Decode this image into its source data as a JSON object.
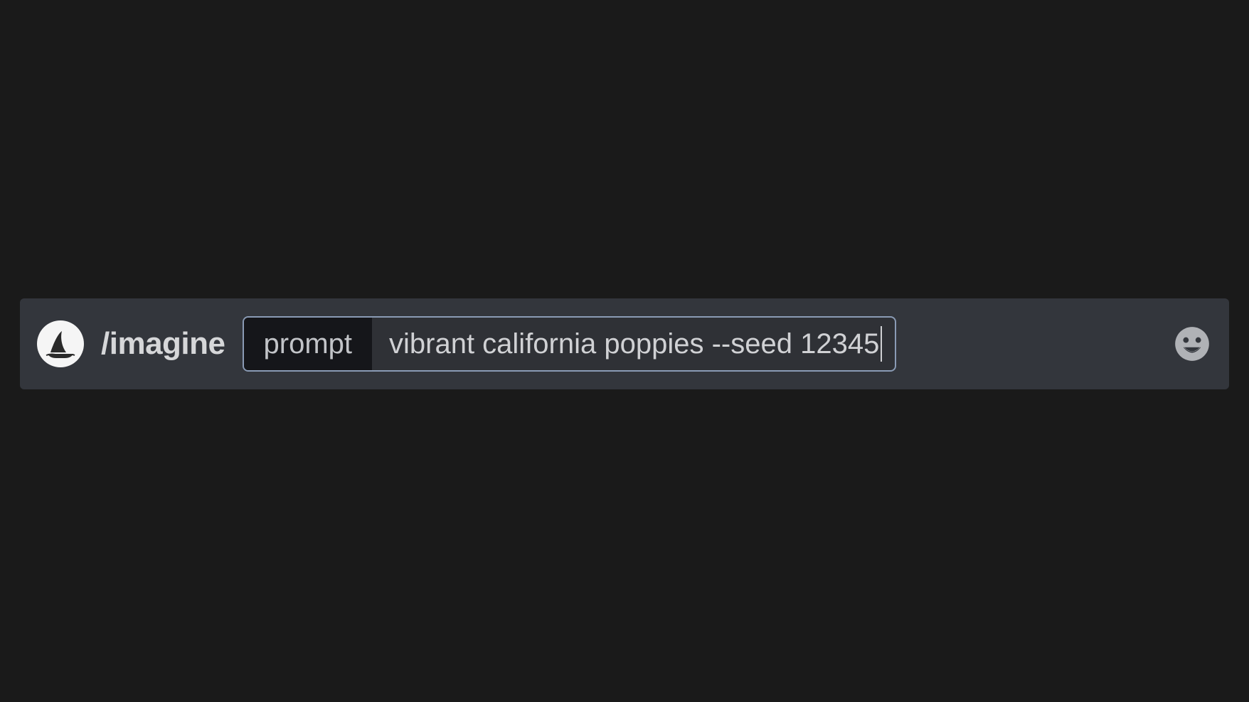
{
  "message_input": {
    "command": "/imagine",
    "param_label": "prompt",
    "param_value": "vibrant california poppies --seed 12345"
  },
  "icons": {
    "bot_avatar": "midjourney-sailboat-icon",
    "emoji_picker": "grinning-face-icon"
  }
}
